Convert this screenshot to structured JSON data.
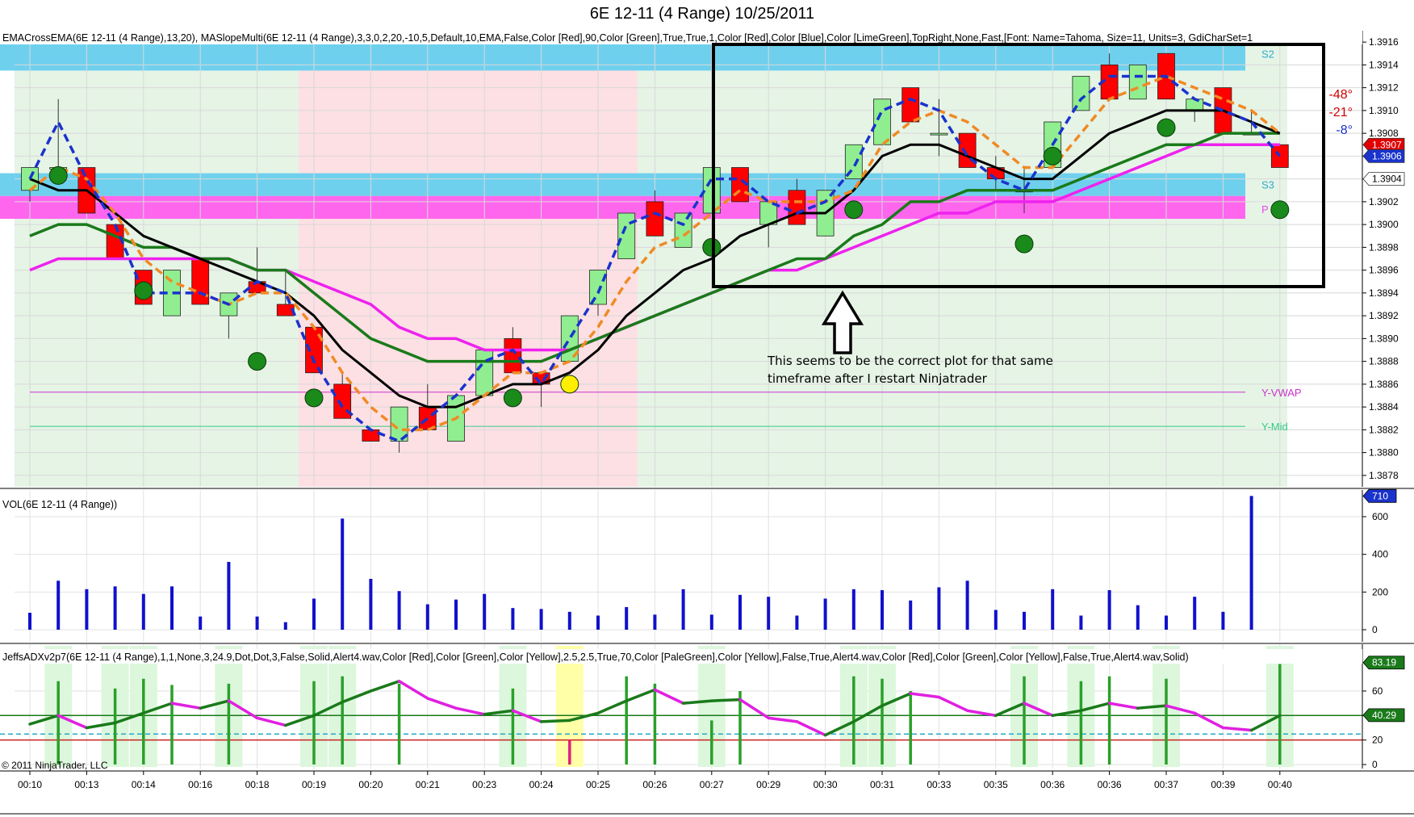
{
  "title": "6E 12-11 (4 Range)  10/25/2011",
  "indicator_labels": {
    "price": "EMACrossEMA(6E  12-11  (4  Range),13,20),  MASlopeMulti(6E  12-11  (4  Range),3,3,0,2,20,-10,5,Default,10,EMA,False,Color  [Red],90,Color  [Green],True,True,1,Color  [Red],Color  [Blue],Color  [LimeGreen],TopRight,None,Fast,[Font:  Name=Tahoma,  Size=11,  Units=3,  GdiCharSet=1",
    "volume": "VOL(6E 12-11 (4 Range))",
    "adx": "JeffsADXv2p7(6E  12-11  (4  Range),1,1,None,3,24.9,Dot,Dot,3,False,Solid,Alert4.wav,Color  [Red],Color  [Green],Color  [Yellow],2.5,2.5,True,70,Color  [PaleGreen],Color  [Yellow],False,True,Alert4.wav,Color  [Red],Color  [Green],Color  [Yellow],False,True,Alert4.wav,Solid)"
  },
  "annotation": {
    "line1": "This seems to be the correct plot for that same",
    "line2": "timeframe after I restart Ninjatrader"
  },
  "copyright": "© 2011 NinjaTrader, LLC",
  "colors": {
    "bull": "#90ee90",
    "bear": "#ff0000",
    "black_ma": "#000000",
    "green_ma": "#1a7a1a",
    "magenta_ma": "#ee22ee",
    "blue_dash": "#1a33cc",
    "orange_dash": "#f08a24",
    "pivot_cyan": "#6fd0ee",
    "pivot_magenta": "#ff66ee",
    "bg_green": "#e6f4e6",
    "bg_pink": "#fde0e4",
    "vol_bar": "#1010cc",
    "adx_green": "#2aa02a",
    "adx_magenta": "#e020e0",
    "vwap": "#cc33cc",
    "ymid": "#33cc88"
  },
  "price_tags": [
    {
      "label": "1.3907",
      "value": 1.3907,
      "color": "#e00000"
    },
    {
      "label": "1.3906",
      "value": 1.3906,
      "color": "#1a33cc"
    },
    {
      "label": "1.3904",
      "value": 1.3904,
      "color": "#ffffff"
    }
  ],
  "slope_angles": [
    {
      "label": "-48°",
      "color": "#cc0000"
    },
    {
      "label": "-21°",
      "color": "#cc0000"
    },
    {
      "label": "-8°",
      "color": "#1a33cc"
    }
  ],
  "level_labels": [
    {
      "label": "S2",
      "value": 1.3915,
      "color": "#33aacc"
    },
    {
      "label": "S3",
      "value": 1.39035,
      "color": "#33aacc"
    },
    {
      "label": "Y-VWAP",
      "value": 1.38853,
      "color": "#cc33cc"
    },
    {
      "label": "Y-Mid",
      "value": 1.38823,
      "color": "#33cc88"
    }
  ],
  "chart_data": [
    {
      "type": "candlestick",
      "panel": "price",
      "ylim": [
        1.3877,
        1.3917
      ],
      "y_ticks": [
        "1.3878",
        "1.3880",
        "1.3882",
        "1.3884",
        "1.3886",
        "1.3888",
        "1.3890",
        "1.3892",
        "1.3894",
        "1.3896",
        "1.3898",
        "1.3900",
        "1.3902",
        "1.3904",
        "1.3906",
        "1.3908",
        "1.3910",
        "1.3912",
        "1.3914",
        "1.3916"
      ],
      "grid": true,
      "candles": [
        {
          "o": 1.3903,
          "c": 1.3905,
          "h": 1.3905,
          "l": 1.3902
        },
        {
          "o": 1.3905,
          "c": 1.3905,
          "h": 1.3911,
          "l": 1.3905
        },
        {
          "o": 1.3905,
          "c": 1.3901,
          "h": 1.3905,
          "l": 1.3901
        },
        {
          "o": 1.39,
          "c": 1.3897,
          "h": 1.39,
          "l": 1.3897
        },
        {
          "o": 1.3896,
          "c": 1.3893,
          "h": 1.3896,
          "l": 1.3893
        },
        {
          "o": 1.3892,
          "c": 1.3896,
          "h": 1.3896,
          "l": 1.3892
        },
        {
          "o": 1.3897,
          "c": 1.3893,
          "h": 1.3897,
          "l": 1.3893
        },
        {
          "o": 1.3892,
          "c": 1.3894,
          "h": 1.3894,
          "l": 1.389
        },
        {
          "o": 1.3895,
          "c": 1.3894,
          "h": 1.3898,
          "l": 1.3894
        },
        {
          "o": 1.3893,
          "c": 1.3892,
          "h": 1.3896,
          "l": 1.3892
        },
        {
          "o": 1.3891,
          "c": 1.3887,
          "h": 1.3891,
          "l": 1.3887
        },
        {
          "o": 1.3886,
          "c": 1.3883,
          "h": 1.3887,
          "l": 1.3883
        },
        {
          "o": 1.3882,
          "c": 1.3881,
          "h": 1.3882,
          "l": 1.3881
        },
        {
          "o": 1.3881,
          "c": 1.3884,
          "h": 1.3884,
          "l": 1.388
        },
        {
          "o": 1.3884,
          "c": 1.3882,
          "h": 1.3886,
          "l": 1.3882
        },
        {
          "o": 1.3881,
          "c": 1.3885,
          "h": 1.3885,
          "l": 1.3881
        },
        {
          "o": 1.3885,
          "c": 1.3889,
          "h": 1.3889,
          "l": 1.3885
        },
        {
          "o": 1.389,
          "c": 1.3887,
          "h": 1.3891,
          "l": 1.3887
        },
        {
          "o": 1.3887,
          "c": 1.3886,
          "h": 1.3887,
          "l": 1.3884
        },
        {
          "o": 1.3888,
          "c": 1.3892,
          "h": 1.3892,
          "l": 1.3888
        },
        {
          "o": 1.3893,
          "c": 1.3896,
          "h": 1.3896,
          "l": 1.3892
        },
        {
          "o": 1.3897,
          "c": 1.3901,
          "h": 1.3901,
          "l": 1.3897
        },
        {
          "o": 1.3902,
          "c": 1.3899,
          "h": 1.3903,
          "l": 1.3899
        },
        {
          "o": 1.3898,
          "c": 1.3901,
          "h": 1.3901,
          "l": 1.3898
        },
        {
          "o": 1.3901,
          "c": 1.3905,
          "h": 1.3905,
          "l": 1.3901
        },
        {
          "o": 1.3905,
          "c": 1.3902,
          "h": 1.3905,
          "l": 1.3902
        },
        {
          "o": 1.39,
          "c": 1.3902,
          "h": 1.3902,
          "l": 1.3898
        },
        {
          "o": 1.3903,
          "c": 1.39,
          "h": 1.3904,
          "l": 1.39
        },
        {
          "o": 1.3899,
          "c": 1.3903,
          "h": 1.3903,
          "l": 1.3899
        },
        {
          "o": 1.3904,
          "c": 1.3907,
          "h": 1.3907,
          "l": 1.3904
        },
        {
          "o": 1.3907,
          "c": 1.3911,
          "h": 1.3911,
          "l": 1.3907
        },
        {
          "o": 1.3912,
          "c": 1.3909,
          "h": 1.3912,
          "l": 1.3909
        },
        {
          "o": 1.3908,
          "c": 1.3908,
          "h": 1.3911,
          "l": 1.3906
        },
        {
          "o": 1.3908,
          "c": 1.3905,
          "h": 1.3908,
          "l": 1.3905
        },
        {
          "o": 1.3905,
          "c": 1.3904,
          "h": 1.3906,
          "l": 1.3903
        },
        {
          "o": 1.3903,
          "c": 1.3903,
          "h": 1.3905,
          "l": 1.3901
        },
        {
          "o": 1.3905,
          "c": 1.3909,
          "h": 1.3909,
          "l": 1.3905
        },
        {
          "o": 1.391,
          "c": 1.3913,
          "h": 1.3913,
          "l": 1.391
        },
        {
          "o": 1.3914,
          "c": 1.3911,
          "h": 1.3915,
          "l": 1.3911
        },
        {
          "o": 1.3911,
          "c": 1.3914,
          "h": 1.3914,
          "l": 1.3911
        },
        {
          "o": 1.3915,
          "c": 1.3911,
          "h": 1.3915,
          "l": 1.3911
        },
        {
          "o": 1.391,
          "c": 1.3911,
          "h": 1.3911,
          "l": 1.3909
        },
        {
          "o": 1.3912,
          "c": 1.3908,
          "h": 1.3912,
          "l": 1.3908
        },
        {
          "o": 1.3908,
          "c": 1.3908,
          "h": 1.391,
          "l": 1.3908
        },
        {
          "o": 1.3907,
          "c": 1.3905,
          "h": 1.3907,
          "l": 1.3905
        }
      ],
      "dots": [
        {
          "i": 1,
          "y": 1.39043,
          "color": "green"
        },
        {
          "i": 4,
          "y": 1.38942,
          "color": "green"
        },
        {
          "i": 8,
          "y": 1.3888,
          "color": "green"
        },
        {
          "i": 10,
          "y": 1.38848,
          "color": "green"
        },
        {
          "i": 17,
          "y": 1.38848,
          "color": "green"
        },
        {
          "i": 19,
          "y": 1.3886,
          "color": "yellow"
        },
        {
          "i": 24,
          "y": 1.3898,
          "color": "green"
        },
        {
          "i": 29,
          "y": 1.39013,
          "color": "green"
        },
        {
          "i": 36,
          "y": 1.3906,
          "color": "green"
        },
        {
          "i": 35,
          "y": 1.38983,
          "color": "green"
        },
        {
          "i": 40,
          "y": 1.39085,
          "color": "green"
        },
        {
          "i": 44,
          "y": 1.39013,
          "color": "green"
        }
      ],
      "series": [
        {
          "style": "black",
          "values": [
            1.3904,
            1.3903,
            1.3903,
            1.3901,
            1.3899,
            1.3898,
            1.3897,
            1.3896,
            1.3895,
            1.3894,
            1.3892,
            1.3889,
            1.3887,
            1.3885,
            1.3884,
            1.3884,
            1.3885,
            1.3886,
            1.3886,
            1.3887,
            1.3889,
            1.3892,
            1.3894,
            1.3896,
            1.3897,
            1.3899,
            1.39,
            1.3901,
            1.3901,
            1.3903,
            1.3906,
            1.3907,
            1.3907,
            1.3906,
            1.3905,
            1.3904,
            1.3904,
            1.3906,
            1.3908,
            1.3909,
            1.391,
            1.391,
            1.391,
            1.3909,
            1.3908
          ]
        },
        {
          "style": "green",
          "values": [
            1.3899,
            1.39,
            1.39,
            1.3899,
            1.3898,
            1.3898,
            1.3897,
            1.3897,
            1.3896,
            1.3896,
            1.3894,
            1.3892,
            1.389,
            1.3889,
            1.3888,
            1.3888,
            1.3888,
            1.3888,
            1.3888,
            1.3889,
            1.389,
            1.3891,
            1.3892,
            1.3893,
            1.3894,
            1.3895,
            1.3896,
            1.3897,
            1.3897,
            1.3899,
            1.39,
            1.3902,
            1.3902,
            1.3903,
            1.3903,
            1.3903,
            1.3903,
            1.3904,
            1.3905,
            1.3906,
            1.3907,
            1.3907,
            1.3908,
            1.3908,
            1.3908
          ]
        },
        {
          "style": "magenta",
          "values": [
            1.3896,
            1.3897,
            1.3897,
            1.3897,
            1.3897,
            1.3897,
            1.3897,
            1.3897,
            1.3896,
            1.3896,
            1.3895,
            1.3894,
            1.3893,
            1.3891,
            1.389,
            1.389,
            1.3889,
            1.3889,
            1.3889,
            1.3889,
            1.389,
            1.3891,
            1.3892,
            1.3893,
            1.3894,
            1.3895,
            1.3896,
            1.3896,
            1.3897,
            1.3898,
            1.3899,
            1.39,
            1.3901,
            1.3901,
            1.3902,
            1.3902,
            1.3902,
            1.3903,
            1.3904,
            1.3905,
            1.3906,
            1.3907,
            1.3907,
            1.3907,
            1.3907
          ]
        },
        {
          "style": "blue_dash",
          "values": [
            1.3904,
            1.3909,
            1.3904,
            1.39,
            1.3894,
            1.3894,
            1.3894,
            1.3893,
            1.3895,
            1.3894,
            1.3888,
            1.3884,
            1.3882,
            1.3881,
            1.3883,
            1.3885,
            1.3888,
            1.3889,
            1.3886,
            1.389,
            1.3894,
            1.39,
            1.3901,
            1.39,
            1.3904,
            1.3904,
            1.3902,
            1.3901,
            1.3902,
            1.3905,
            1.391,
            1.3911,
            1.391,
            1.3906,
            1.3904,
            1.3903,
            1.3907,
            1.3911,
            1.3913,
            1.3913,
            1.3913,
            1.3911,
            1.391,
            1.3909,
            1.3906
          ]
        },
        {
          "style": "orange_dash",
          "values": [
            1.3903,
            1.3905,
            1.3904,
            1.3901,
            1.3897,
            1.3895,
            1.3894,
            1.3893,
            1.3894,
            1.3894,
            1.3891,
            1.3887,
            1.3884,
            1.3882,
            1.3882,
            1.3883,
            1.3885,
            1.3887,
            1.3887,
            1.3888,
            1.3891,
            1.3895,
            1.3898,
            1.3899,
            1.3901,
            1.3903,
            1.3902,
            1.3902,
            1.3902,
            1.3903,
            1.3907,
            1.3909,
            1.391,
            1.3909,
            1.3907,
            1.3905,
            1.3905,
            1.3908,
            1.3911,
            1.3912,
            1.3913,
            1.3912,
            1.3911,
            1.391,
            1.3908
          ]
        }
      ]
    },
    {
      "type": "bar",
      "panel": "volume",
      "ylim": [
        0,
        720
      ],
      "y_ticks": [
        "0",
        "200",
        "400",
        "600"
      ],
      "last_value_label": "710",
      "values": [
        90,
        260,
        215,
        230,
        190,
        230,
        70,
        360,
        70,
        40,
        165,
        590,
        270,
        205,
        135,
        160,
        190,
        115,
        110,
        95,
        75,
        120,
        80,
        215,
        80,
        185,
        175,
        75,
        165,
        215,
        210,
        155,
        225,
        260,
        105,
        95,
        215,
        75,
        210,
        130,
        75,
        175,
        95,
        710
      ]
    },
    {
      "type": "line",
      "panel": "adx",
      "ylim": [
        0,
        85
      ],
      "y_ticks": [
        "0",
        "20",
        "40",
        "60"
      ],
      "value_labels": [
        "83.19",
        "40.29"
      ],
      "ref_lines": [
        {
          "y": 40,
          "color": "#1a7a1a"
        },
        {
          "y": 24.9,
          "color": "#22aacc"
        },
        {
          "y": 20,
          "color": "#cc2222"
        }
      ],
      "adx_values": [
        33,
        40,
        30,
        34,
        42,
        50,
        46,
        52,
        38,
        32,
        40,
        51,
        60,
        68,
        54,
        46,
        41,
        44,
        35,
        36,
        42,
        52,
        61,
        50,
        52,
        53,
        38,
        35,
        24,
        35,
        48,
        58,
        55,
        44,
        40,
        50,
        40,
        44,
        50,
        46,
        48,
        42,
        30,
        28,
        40
      ],
      "spikes": [
        {
          "i": 1,
          "h": 68,
          "c": "g"
        },
        {
          "i": 3,
          "h": 62,
          "c": "g"
        },
        {
          "i": 4,
          "h": 70,
          "c": "g"
        },
        {
          "i": 5,
          "h": 65,
          "c": "g"
        },
        {
          "i": 7,
          "h": 66,
          "c": "g"
        },
        {
          "i": 10,
          "h": 68,
          "c": "g"
        },
        {
          "i": 11,
          "h": 72,
          "c": "g"
        },
        {
          "i": 13,
          "h": 66,
          "c": "g"
        },
        {
          "i": 17,
          "h": 62,
          "c": "g"
        },
        {
          "i": 19,
          "h": 20,
          "c": "m"
        },
        {
          "i": 21,
          "h": 72,
          "c": "g"
        },
        {
          "i": 22,
          "h": 66,
          "c": "g"
        },
        {
          "i": 24,
          "h": 36,
          "c": "g"
        },
        {
          "i": 25,
          "h": 60,
          "c": "g"
        },
        {
          "i": 29,
          "h": 72,
          "c": "g"
        },
        {
          "i": 30,
          "h": 70,
          "c": "g"
        },
        {
          "i": 31,
          "h": 60,
          "c": "g"
        },
        {
          "i": 35,
          "h": 72,
          "c": "g"
        },
        {
          "i": 37,
          "h": 68,
          "c": "g"
        },
        {
          "i": 38,
          "h": 72,
          "c": "g"
        },
        {
          "i": 40,
          "h": 70,
          "c": "g"
        },
        {
          "i": 44,
          "h": 82,
          "c": "g"
        }
      ],
      "highlights": [
        {
          "i": 1,
          "c": "g"
        },
        {
          "i": 3,
          "c": "g"
        },
        {
          "i": 4,
          "c": "g"
        },
        {
          "i": 7,
          "c": "g"
        },
        {
          "i": 10,
          "c": "g"
        },
        {
          "i": 11,
          "c": "g"
        },
        {
          "i": 17,
          "c": "g"
        },
        {
          "i": 19,
          "c": "y"
        },
        {
          "i": 24,
          "c": "g"
        },
        {
          "i": 29,
          "c": "g"
        },
        {
          "i": 30,
          "c": "g"
        },
        {
          "i": 35,
          "c": "g"
        },
        {
          "i": 37,
          "c": "g"
        },
        {
          "i": 40,
          "c": "g"
        },
        {
          "i": 44,
          "c": "g"
        }
      ]
    }
  ],
  "x_tick_labels": [
    "00:10",
    "00:13",
    "00:14",
    "00:16",
    "00:18",
    "00:19",
    "00:20",
    "00:21",
    "00:23",
    "00:24",
    "00:25",
    "00:26",
    "00:27",
    "00:29",
    "00:30",
    "00:31",
    "00:33",
    "00:35",
    "00:36",
    "00:36",
    "00:37",
    "00:39",
    "00:40"
  ]
}
